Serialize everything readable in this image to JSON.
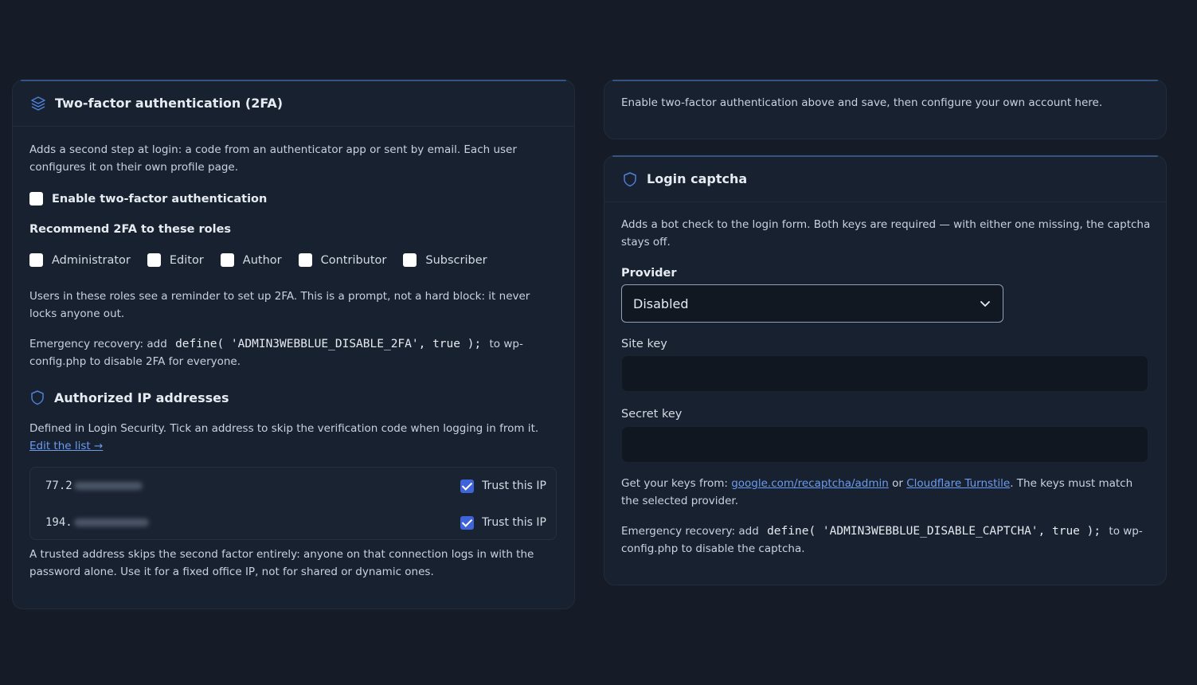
{
  "twofa": {
    "title": "Two-factor authentication (2FA)",
    "description": "Adds a second step at login: a code from an authenticator app or sent by email. Each user configures it on their own profile page.",
    "enable_label": "Enable two-factor authentication",
    "enable_checked": false,
    "roles_heading": "Recommend 2FA to these roles",
    "roles": [
      {
        "label": "Administrator",
        "checked": false
      },
      {
        "label": "Editor",
        "checked": false
      },
      {
        "label": "Author",
        "checked": false
      },
      {
        "label": "Contributor",
        "checked": false
      },
      {
        "label": "Subscriber",
        "checked": false
      }
    ],
    "roles_note": "Users in these roles see a reminder to set up 2FA. This is a prompt, not a hard block: it never locks anyone out.",
    "recovery_prefix": "Emergency recovery: add",
    "recovery_code": "define( 'ADMIN3WEBBLUE_DISABLE_2FA', true );",
    "recovery_suffix": "to wp-config.php to disable 2FA for everyone."
  },
  "authorized_ips": {
    "title": "Authorized IP addresses",
    "description": "Defined in Login Security. Tick an address to skip the verification code when logging in from it.",
    "edit_link": "Edit the list →",
    "items": [
      {
        "ip": "77.2",
        "trust_label": "Trust this IP",
        "checked": true
      },
      {
        "ip": "194.",
        "trust_label": "Trust this IP",
        "checked": true
      }
    ],
    "note": "A trusted address skips the second factor entirely: anyone on that connection logs in with the password alone. Use it for a fixed office IP, not for shared or dynamic ones."
  },
  "account_note": "Enable two-factor authentication above and save, then configure your own account here.",
  "captcha": {
    "title": "Login captcha",
    "description": "Adds a bot check to the login form. Both keys are required — with either one missing, the captcha stays off.",
    "provider_label": "Provider",
    "provider_value": "Disabled",
    "site_key_label": "Site key",
    "site_key_value": "",
    "secret_key_label": "Secret key",
    "secret_key_value": "",
    "keys_prefix": "Get your keys from:",
    "keys_link1": "google.com/recaptcha/admin",
    "keys_or": "or",
    "keys_link2": "Cloudflare Turnstile",
    "keys_suffix": ". The keys must match the selected provider.",
    "recovery_prefix": "Emergency recovery: add",
    "recovery_code": "define( 'ADMIN3WEBBLUE_DISABLE_CAPTCHA', true );",
    "recovery_suffix": "to wp-config.php to disable the captcha."
  },
  "colors": {
    "background": "#151c27",
    "panel": "#182130",
    "accent": "#3f63d9",
    "link": "#6b9cf0"
  },
  "icons": {
    "twofa": "layers-icon",
    "shield": "shield-icon",
    "select": "chevron-down-icon"
  }
}
